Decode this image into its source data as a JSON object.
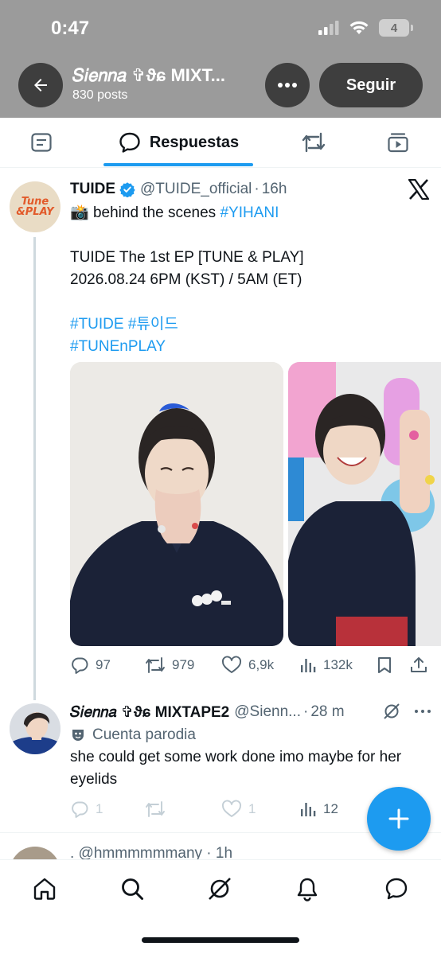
{
  "status_bar": {
    "time": "0:47",
    "battery": "4"
  },
  "profile": {
    "name": "𝑆𝑖𝑒𝑛𝑛𝑎 ✞ϑɕ MIXT...",
    "posts_count": "830 posts",
    "follow_label": "Seguir"
  },
  "tabs": {
    "replies_label": "Respuestas",
    "active": "replies"
  },
  "tweet1": {
    "display_name": "TUIDE",
    "handle": "@TUIDE_official",
    "separator": "·",
    "time": "16h",
    "avatar_text": [
      "Tune",
      "&PLAY"
    ],
    "emoji": "📸",
    "line1_text": "behind the scenes",
    "line1_hashtag": "#YIHANI",
    "line2": "TUIDE The 1st EP [TUNE & PLAY]",
    "line3": "2026.08.24 6PM (KST) / 5AM (ET)",
    "hashtags_a": "#TUIDE #튜이드",
    "hashtags_b": "#TUNEnPLAY",
    "stats": {
      "replies": "97",
      "reposts": "979",
      "likes": "6,9k",
      "views": "132k"
    }
  },
  "tweet2": {
    "display_name": "𝑆𝑖𝑒𝑛𝑛𝑎 ✞ϑɕ MIXTAPE2",
    "handle": "@Sienn...",
    "separator": "·",
    "time": "28 m",
    "parody_label": "Cuenta parodia",
    "text": "she could get some work done imo maybe for her eyelids",
    "stats": {
      "replies": "1",
      "reposts": "",
      "likes": "1",
      "views": "12"
    }
  },
  "tweet3": {
    "handle_line": ". @hmmmmmmany · 1h"
  },
  "colors": {
    "accent": "#1d9bf0",
    "header_bg": "#9b9b9b",
    "text_primary": "#0f1419",
    "text_secondary": "#536471"
  },
  "icons": {
    "header": [
      "back-arrow-icon",
      "more-icon"
    ],
    "tabs": [
      "posts-icon",
      "speech-bubble-icon",
      "repost-icon",
      "media-icon"
    ],
    "actions": [
      "reply-icon",
      "repost-icon",
      "like-icon",
      "views-icon",
      "bookmark-icon",
      "share-icon"
    ],
    "nav": [
      "home-icon",
      "search-icon",
      "grok-icon",
      "notifications-icon",
      "messages-icon"
    ]
  }
}
